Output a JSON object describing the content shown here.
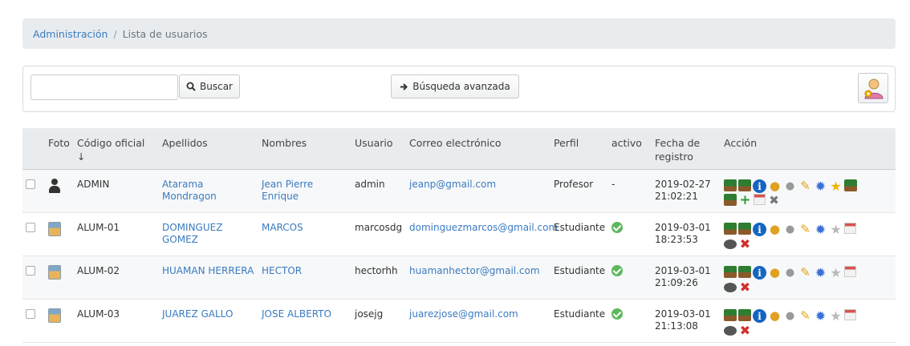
{
  "breadcrumb": {
    "root": "Administración",
    "separator": "/",
    "current": "Lista de usuarios"
  },
  "search": {
    "placeholder": "",
    "value": "",
    "button_label": "Buscar",
    "advanced_label": "Búsqueda avanzada"
  },
  "table": {
    "headers": {
      "photo": "Foto",
      "code": "Código oficial",
      "sort_indicator": "↓",
      "lastname": "Apellidos",
      "firstname": "Nombres",
      "user": "Usuario",
      "email": "Correo electrónico",
      "profile": "Perfil",
      "active": "activo",
      "reg_date_1": "Fecha de",
      "reg_date_2": "registro",
      "action": "Acción"
    },
    "rows": [
      {
        "code": "ADMIN",
        "lastname_1": "Atarama",
        "lastname_2": "Mondragon",
        "firstname_1": "Jean Pierre",
        "firstname_2": "Enrique",
        "user": "admin",
        "email": "jeanp@gmail.com",
        "profile": "Profesor",
        "active": "-",
        "date": "2019-02-27",
        "time": "21:02:21"
      },
      {
        "code": "ALUM-01",
        "lastname_1": "DOMINGUEZ",
        "lastname_2": "GOMEZ",
        "firstname_1": "MARCOS",
        "firstname_2": "",
        "user": "marcosdg",
        "email": "dominguezmarcos@gmail.com",
        "profile": "Estudiante",
        "active": "",
        "date": "2019-03-01",
        "time": "18:23:53"
      },
      {
        "code": "ALUM-02",
        "lastname_1": "HUAMAN HERRERA",
        "lastname_2": "",
        "firstname_1": "HECTOR",
        "firstname_2": "",
        "user": "hectorhh",
        "email": "huamanhector@gmail.com",
        "profile": "Estudiante",
        "active": "",
        "date": "2019-03-01",
        "time": "21:09:26"
      },
      {
        "code": "ALUM-03",
        "lastname_1": "JUAREZ GALLO",
        "lastname_2": "",
        "firstname_1": "JOSE ALBERTO",
        "firstname_2": "",
        "user": "josejg",
        "email": "juarezjose@gmail.com",
        "profile": "Estudiante",
        "active": "",
        "date": "2019-03-01",
        "time": "21:13:08"
      }
    ]
  },
  "icons": {
    "search": "search-icon",
    "arrow": "arrow-right-icon",
    "user_settings": "user-settings-icon",
    "active_ok": "check-circle-icon"
  },
  "colors": {
    "link": "#3a7bc0",
    "header_bg": "#e8ecef",
    "active_ok": "#5cb85c"
  }
}
